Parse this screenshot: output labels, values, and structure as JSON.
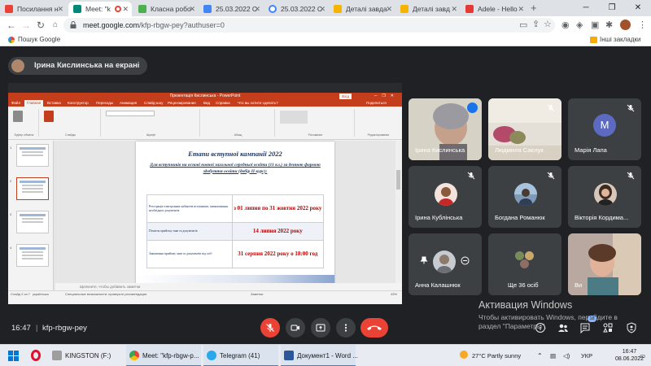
{
  "browser": {
    "tabs": [
      {
        "label": "Посилання н",
        "favicon_color": "#ea4335",
        "active": false
      },
      {
        "label": "Meet: \"k",
        "favicon_color": "#00897b",
        "active": true
      },
      {
        "label": "Класна робо",
        "favicon_color": "#4caf50",
        "active": false
      },
      {
        "label": "25.03.2022 C",
        "favicon_color": "#4285f4",
        "active": false
      },
      {
        "label": "25.03.2022 C",
        "favicon_color": "#4285f4",
        "active": false
      },
      {
        "label": "Деталі завда",
        "favicon_color": "#f4b400",
        "active": false
      },
      {
        "label": "Деталі завд",
        "favicon_color": "#f4b400",
        "active": false
      },
      {
        "label": "Adele - Hello",
        "favicon_color": "#e53935",
        "active": false
      }
    ],
    "new_tab": "+",
    "window_controls": {
      "minimize": "─",
      "maximize": "❐",
      "close": "✕"
    },
    "url_host": "meet.google.com",
    "url_path": "/kfp-rbgw-pey?authuser=0",
    "bookmarks": {
      "left": "Пошук Google",
      "right": "Інші закладки"
    }
  },
  "meet": {
    "presenter_label": "Ірина Кислинська на екрані",
    "clock": "16:47",
    "meeting_code": "kfp-rbgw-pey",
    "participants_count": "18",
    "participants": [
      {
        "name": "Ірина Кислинська",
        "type": "video",
        "speaking": true
      },
      {
        "name": "Людмила Саєлук",
        "type": "video",
        "speaking": false
      },
      {
        "name": "Марія Лапа",
        "type": "letter",
        "letter": "M",
        "speaking": false
      },
      {
        "name": "Ірина Кублінська",
        "type": "avatar",
        "speaking": false
      },
      {
        "name": "Богдана Романюк",
        "type": "avatar",
        "speaking": false
      },
      {
        "name": "Вікторія Кордима...",
        "type": "avatar",
        "speaking": false
      },
      {
        "name": "Анна Калашнюк",
        "type": "avatar",
        "speaking": false
      },
      {
        "name": "Ще 36 осіб",
        "type": "group",
        "speaking": false
      },
      {
        "name": "Ви",
        "type": "video",
        "speaking": false
      }
    ],
    "activation": {
      "title": "Активация Windows",
      "text": "Чтобы активировать Windows, перейдите в раздел \"Параметры\"."
    }
  },
  "powerpoint": {
    "window_title": "Презентація Кислинська - PowerPoint",
    "signin": "Вхід",
    "ribbon_tabs": [
      "Файл",
      "Главная",
      "Вставка",
      "Конструктор",
      "Переходы",
      "Анимация",
      "Слайд-шоу",
      "Рецензирование",
      "Вид",
      "Справка",
      "Что вы хотите сделать?",
      "Поделиться"
    ],
    "ribbon_groups": [
      "Буфер обмена",
      "Слайды",
      "Шрифт",
      "Абзац",
      "Рисование",
      "Редактирование"
    ],
    "notes_placeholder": "Щелкните, чтобы добавить заметки",
    "status_left": "Слайд 2 из 7",
    "status_lang": "українська",
    "status_access": "Специальные возможности: проверьте рекомендации",
    "status_right": "Заметки",
    "zoom": "43%",
    "thumb_numbers": [
      "1",
      "2",
      "3",
      "4"
    ],
    "slide": {
      "title": "Етапи вступної кампанії 2022",
      "subtitle": "Для вступників на основі повної загальної середньої освіти (11 кл.) за денною формою здобуття освіти (добір II курс):",
      "rows": [
        {
          "label": "Реєстрація електронних кабінетів вступників, завантаження необхідних документів",
          "value": "з 01 липня по 31 жовтня 2022 року"
        },
        {
          "label": "Початок прийому заяв та документів",
          "value": "14 липня 2022 року"
        },
        {
          "label": "Закінчення прийому заяв та документів від осіб",
          "value": "31 серпня 2022 року о 18:00 год"
        }
      ]
    }
  },
  "taskbar": {
    "items": [
      {
        "label": "KINGSTON (F:)",
        "color": "#9e9e9e"
      },
      {
        "label": "Meet: \"kfp-rbgw-p...",
        "color": "#4285f4",
        "open": true
      },
      {
        "label": "Telegram (41)",
        "color": "#29a9eb",
        "open": true
      },
      {
        "label": "Документ1 - Word ...",
        "color": "#2b579a",
        "open": true
      }
    ],
    "weather": "27°C  Partly sunny",
    "language": "УКР",
    "time": "16:47",
    "date": "08.06.2022"
  }
}
